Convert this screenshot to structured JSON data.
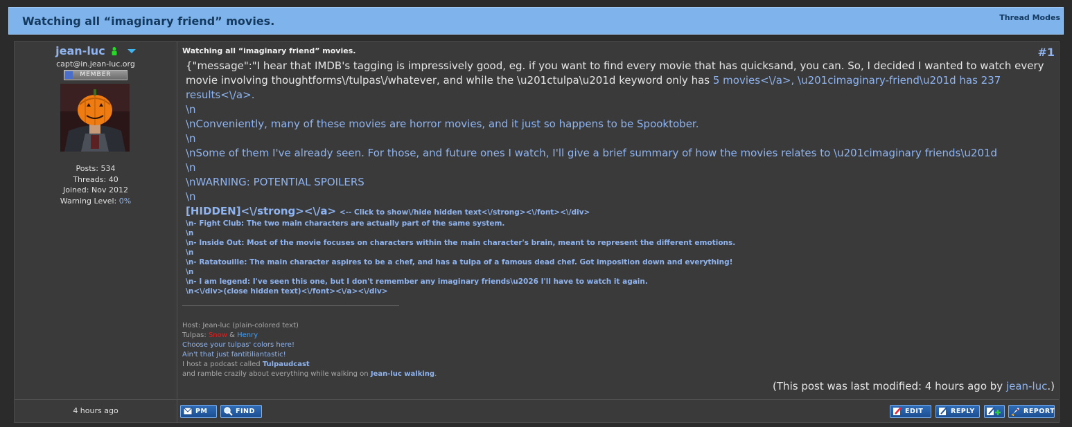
{
  "header": {
    "title": "Watching all “imaginary friend” movies.",
    "thread_modes": "Thread Modes"
  },
  "author": {
    "username": "jean-luc",
    "email": "capt@in.jean-luc.org",
    "rank": "MEMBER",
    "posts": "Posts: 534",
    "threads": "Threads: 40",
    "joined": "Joined: Nov 2012",
    "warning_label": "Warning Level:",
    "warning_value": "0%",
    "post_time": "4 hours ago"
  },
  "post": {
    "subject": "Watching all “imaginary friend” movies.",
    "number": "#1",
    "msg_intro": "{\"message\":\"I hear that IMDB's tagging is impressively good, eg. if you want to find every movie that has quicksand, you can. So, I decided I wanted to watch every movie involving thoughtforms\\/tulpas\\/whatever, and while the \\u201ctulpa\\u201d keyword only has ",
    "msg_link": "5 movies<\\/a>, \\u201cimaginary-friend\\u201d has 237 results<\\/a>.",
    "lines": [
      "\\n",
      "\\nConveniently, many of these movies are horror movies, and it just so happens to be Spooktober.",
      "\\n",
      "\\nSome of them I've already seen. For those, and future ones I watch, I'll give a brief summary of how the movies relates to \\u201cimaginary friends\\u201d",
      "\\n",
      "\\nWARNING: POTENTIAL SPOILERS",
      "\\n"
    ],
    "hidden_label": "[HIDDEN]<\\/strong><\\/a>",
    "hidden_hint": "<-- Click to show\\/hide hidden text<\\/strong><\\/font><\\/div>",
    "hidden_lines": [
      "\\n- Fight Club: The two main characters are actually part of the same system.",
      "\\n",
      "\\n- Inside Out: Most of the movie focuses on characters within the main character's brain, meant to represent the different emotions.",
      "\\n",
      "\\n- Ratatouille: The main character aspires to be a chef, and has a tulpa of a famous dead chef. Got imposition down and everything!",
      "\\n",
      "\\n- I am legend: I've seen this one, but I don't remember any imaginary friends\\u2026 I'll have to watch it again.",
      "\\n<\\/div>(close hidden text)<\\/font><\\/a><\\/div>"
    ],
    "modified_prefix": "(This post was last modified: 4 hours ago by ",
    "modified_user": "jean-luc",
    "modified_suffix": ".)"
  },
  "signature": {
    "host": "Host: Jean-luc (plain-colored text)",
    "tulpas_label": "Tulpas: ",
    "tulpa1": "Snow",
    "amp": " & ",
    "tulpa2": "Henry",
    "colors_link": "Choose your tulpas' colors here!",
    "fantastic": "Ain't that just fantitiliantastic!",
    "podcast_prefix": "I host a podcast called ",
    "podcast_name": "Tulpaudcast",
    "ramble_prefix": "and ramble crazily about everything while walking on ",
    "ramble_link": "Jean-luc walking",
    "ramble_suffix": "."
  },
  "buttons": {
    "pm": "PM",
    "find": "FIND",
    "edit": "EDIT",
    "reply": "REPLY",
    "report": "REPORT"
  },
  "colors": {
    "header_bg": "#7eb3ec",
    "link": "#8fb4f0",
    "button": "#2f6db8"
  }
}
